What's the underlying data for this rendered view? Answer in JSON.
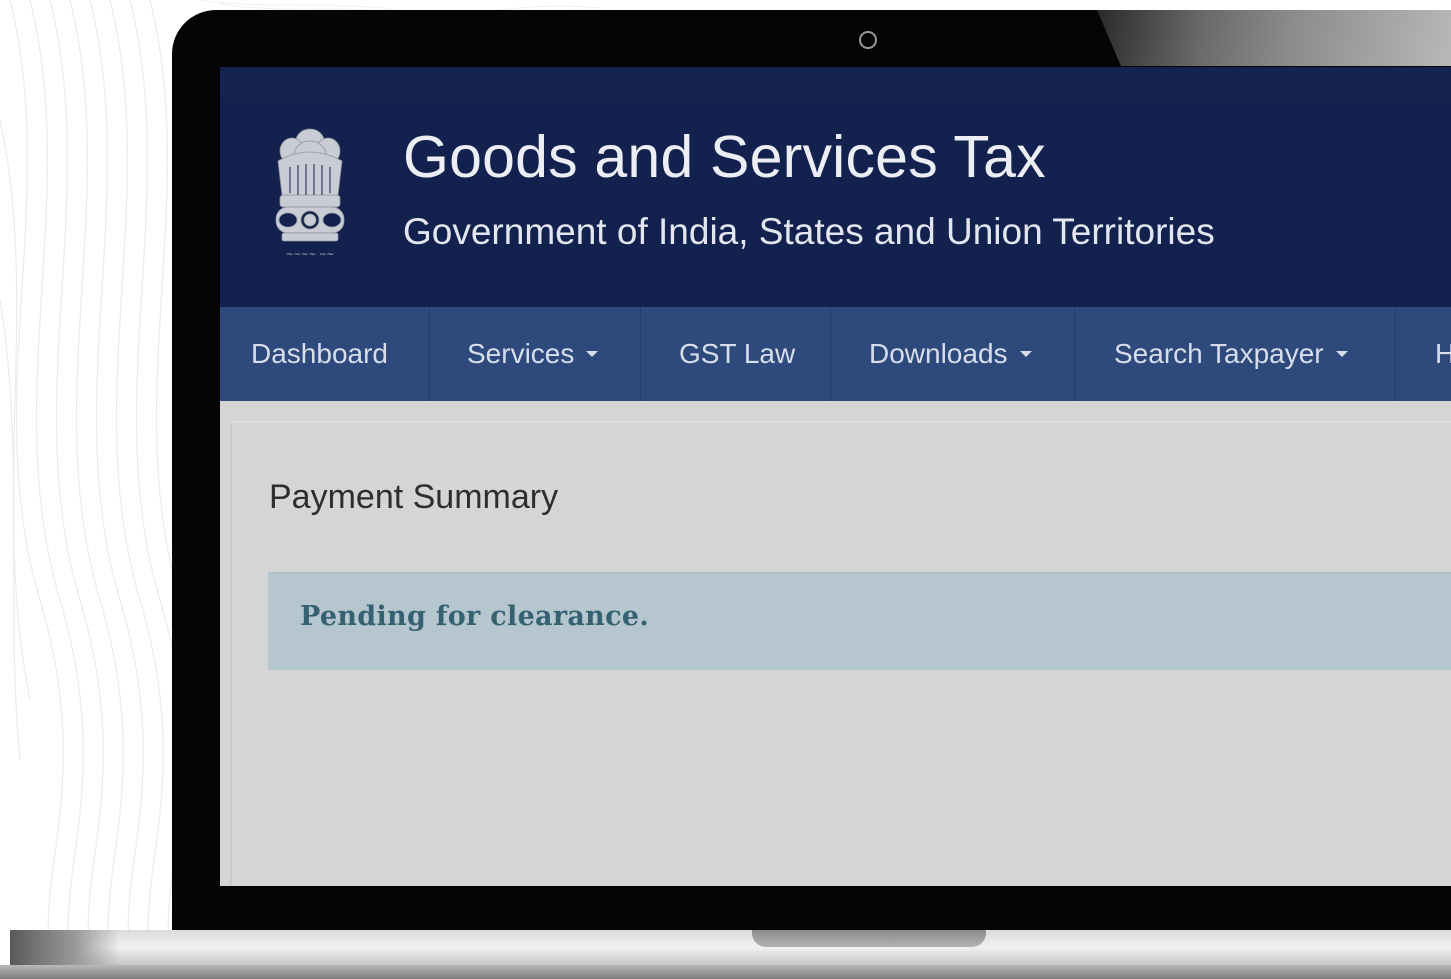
{
  "header": {
    "title": "Goods and Services Tax",
    "subtitle": "Government of India, States and Union Territories",
    "emblem_icon": "national-emblem-icon"
  },
  "nav": {
    "items": [
      {
        "label": "Dashboard",
        "dropdown": false
      },
      {
        "label": "Services",
        "dropdown": true
      },
      {
        "label": "GST Law",
        "dropdown": false
      },
      {
        "label": "Downloads",
        "dropdown": true
      },
      {
        "label": "Search Taxpayer",
        "dropdown": true
      },
      {
        "label": "H",
        "dropdown": false
      }
    ]
  },
  "main": {
    "panel_title": "Payment Summary",
    "alert_text": "Pending for clearance."
  },
  "colors": {
    "header_bg": "#12214d",
    "nav_bg": "#2e4a7d",
    "content_bg": "#d5d5d5",
    "alert_bg": "#b6c6cf",
    "alert_text": "#356270"
  }
}
